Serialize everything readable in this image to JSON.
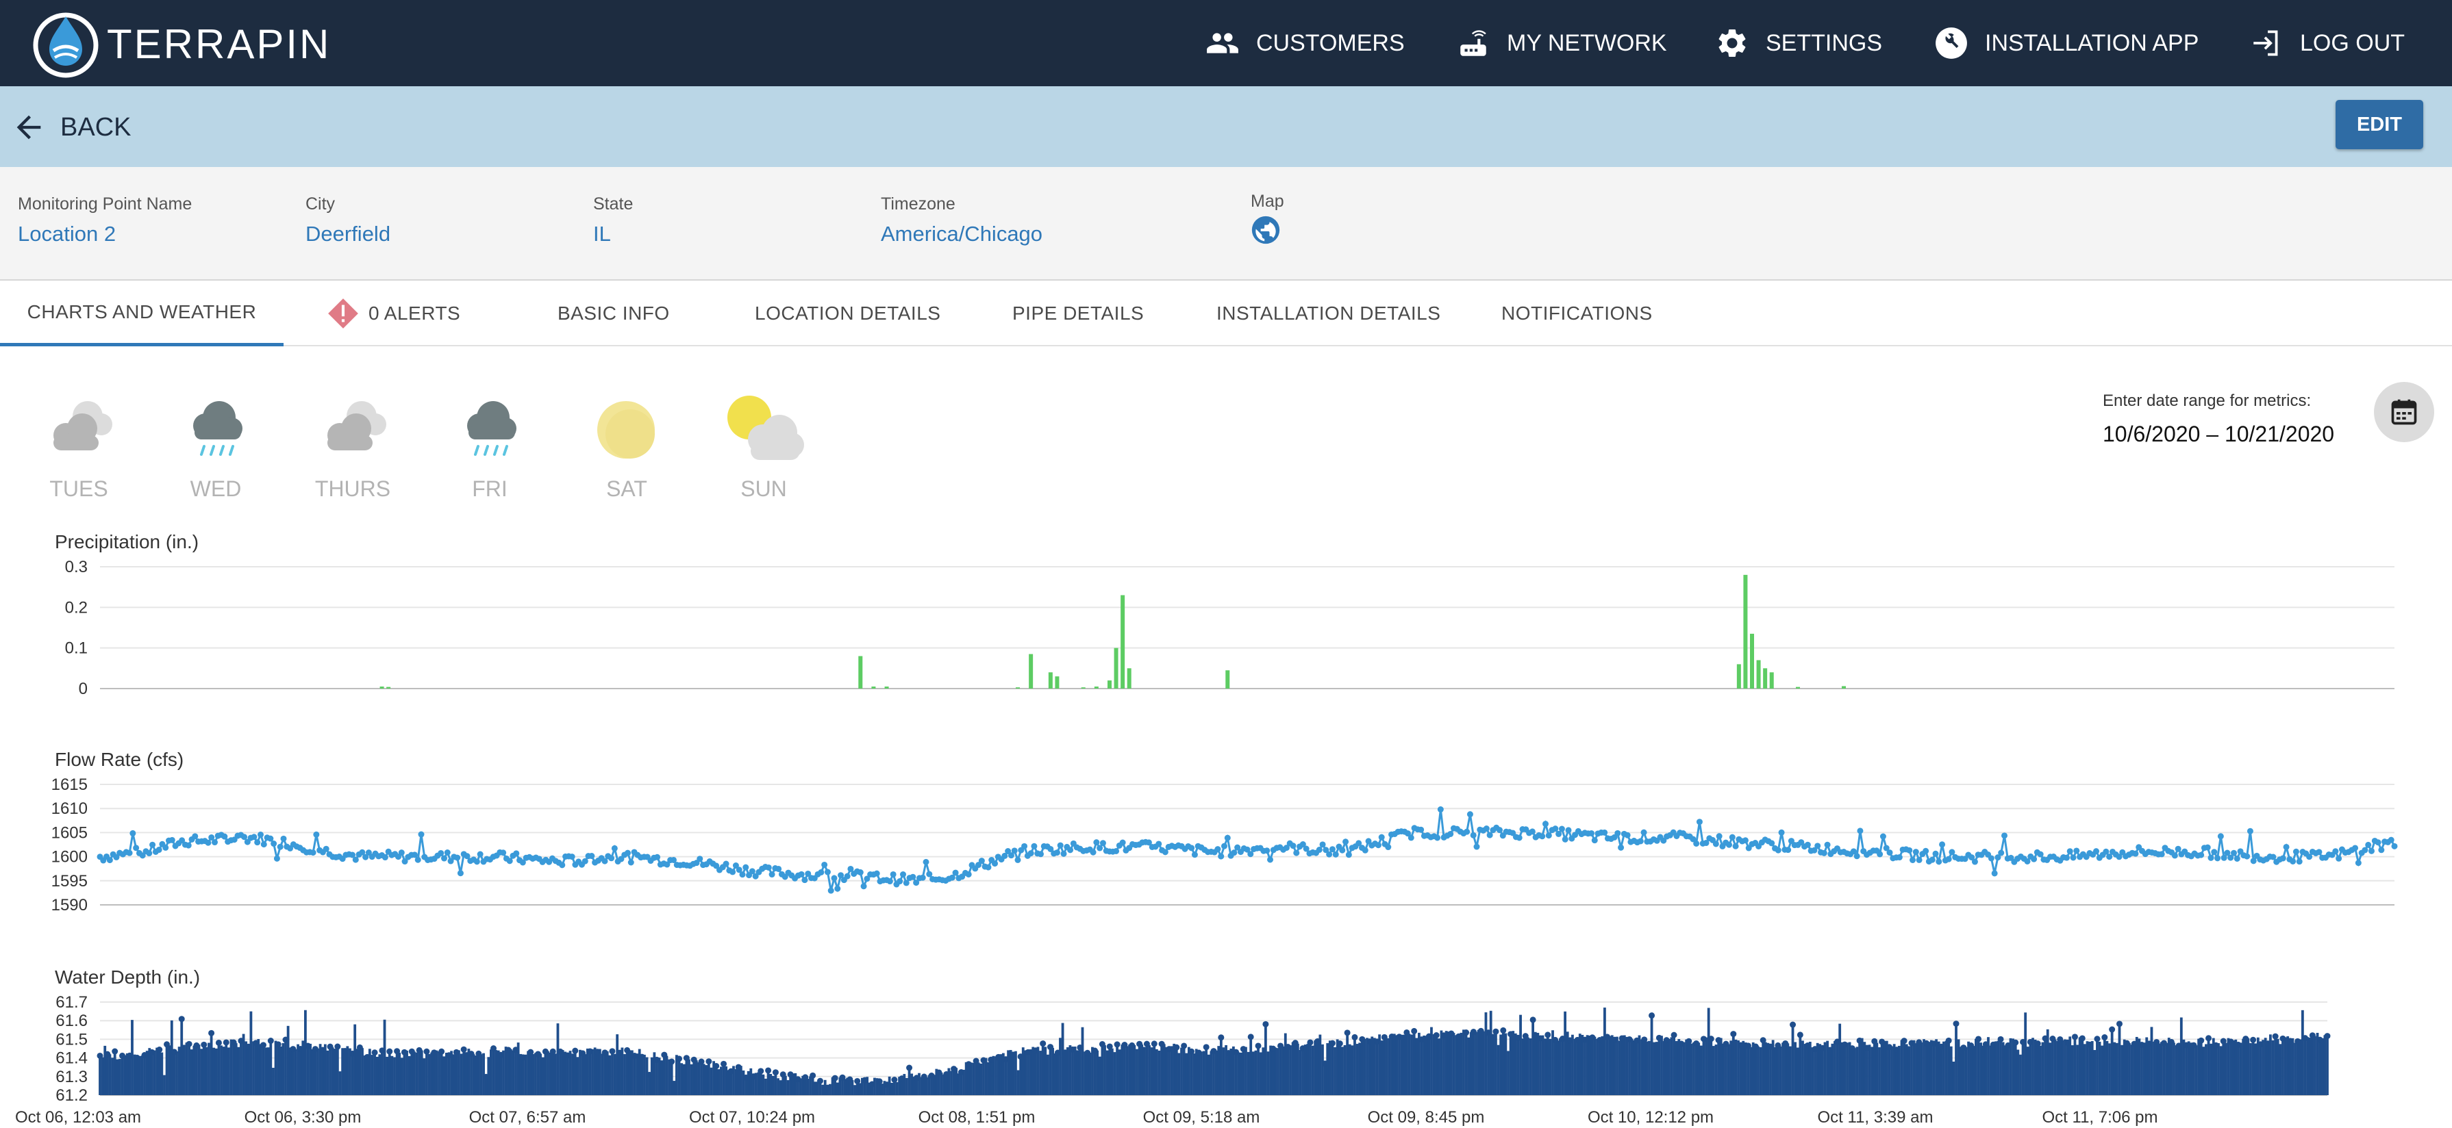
{
  "brand": {
    "name": "TERRAPIN",
    "icon": "terrapin-drop-logo"
  },
  "nav": [
    {
      "label": "CUSTOMERS",
      "icon": "people-icon"
    },
    {
      "label": "MY NETWORK",
      "icon": "router-icon"
    },
    {
      "label": "SETTINGS",
      "icon": "gear-icon"
    },
    {
      "label": "INSTALLATION APP",
      "icon": "wrench-icon"
    },
    {
      "label": "LOG OUT",
      "icon": "logout-icon"
    }
  ],
  "backbar": {
    "back_label": "BACK",
    "edit_label": "EDIT"
  },
  "info": [
    {
      "label": "Monitoring Point Name",
      "value": "Location 2"
    },
    {
      "label": "City",
      "value": "Deerfield"
    },
    {
      "label": "State",
      "value": "IL"
    },
    {
      "label": "Timezone",
      "value": "America/Chicago"
    },
    {
      "label": "Map",
      "icon": "globe-icon"
    }
  ],
  "tabs": [
    {
      "label": "CHARTS AND WEATHER",
      "active": true
    },
    {
      "label": "0 ALERTS",
      "icon": "alert-diamond-icon"
    },
    {
      "label": "BASIC INFO"
    },
    {
      "label": "LOCATION DETAILS"
    },
    {
      "label": "PIPE DETAILS"
    },
    {
      "label": "INSTALLATION DETAILS"
    },
    {
      "label": "NOTIFICATIONS"
    }
  ],
  "weather": [
    {
      "day": "TUES",
      "icon": "cloudy-icon"
    },
    {
      "day": "WED",
      "icon": "rain-icon"
    },
    {
      "day": "THURS",
      "icon": "cloudy-icon"
    },
    {
      "day": "FRI",
      "icon": "rain-icon"
    },
    {
      "day": "SAT",
      "icon": "sun-icon"
    },
    {
      "day": "SUN",
      "icon": "partly-cloudy-icon"
    }
  ],
  "date_range": {
    "label": "Enter date range for metrics:",
    "value": "10/6/2020 – 10/21/2020",
    "icon": "calendar-icon"
  },
  "colors": {
    "navbar": "#1d2c40",
    "backbar": "#bad6e6",
    "link": "#2f78b8",
    "precip": "#5dcc63",
    "flow": "#3a9ad9",
    "depth": "#1f4e8c",
    "alert": "#e07b86"
  },
  "chart_data": [
    {
      "type": "bar",
      "title": "Precipitation (in.)",
      "ylabel": "Precipitation (in.)",
      "ylim": [
        0,
        0.3
      ],
      "yticks": [
        "0.3",
        "0.2",
        "0.1",
        "0"
      ],
      "x_index_range": [
        0,
        350
      ],
      "points": [
        [
          43,
          0.005
        ],
        [
          44,
          0.004
        ],
        [
          116,
          0.08
        ],
        [
          118,
          0.005
        ],
        [
          120,
          0.005
        ],
        [
          140,
          0.003
        ],
        [
          142,
          0.085
        ],
        [
          145,
          0.04
        ],
        [
          146,
          0.03
        ],
        [
          150,
          0.003
        ],
        [
          152,
          0.005
        ],
        [
          154,
          0.02
        ],
        [
          155,
          0.1
        ],
        [
          156,
          0.23
        ],
        [
          157,
          0.05
        ],
        [
          172,
          0.045
        ],
        [
          250,
          0.06
        ],
        [
          251,
          0.28
        ],
        [
          252,
          0.135
        ],
        [
          253,
          0.07
        ],
        [
          254,
          0.05
        ],
        [
          255,
          0.04
        ],
        [
          259,
          0.004
        ],
        [
          266,
          0.006
        ]
      ],
      "grid": true
    },
    {
      "type": "scatter",
      "title": "Flow Rate (cfs)",
      "ylabel": "Flow Rate (cfs)",
      "ylim": [
        1590,
        1615
      ],
      "yticks": [
        "1615",
        "1610",
        "1605",
        "1600",
        "1595",
        "1590"
      ],
      "trend_x": [
        0,
        7,
        12,
        23,
        28,
        35,
        40,
        50,
        60,
        70,
        80,
        90,
        100,
        110,
        115,
        125,
        130,
        140,
        150,
        160,
        170,
        180,
        190,
        200,
        210,
        220,
        230,
        240,
        250,
        260,
        270,
        280,
        290,
        300,
        310,
        320,
        330,
        340,
        350
      ],
      "trend_y": [
        1600,
        1601,
        1603,
        1604,
        1603,
        1601,
        1600,
        1600,
        1600,
        1599,
        1600,
        1599,
        1597,
        1596,
        1596,
        1595,
        1596,
        1601,
        1602,
        1602,
        1601,
        1602,
        1601,
        1605,
        1605,
        1605,
        1604,
        1604,
        1603,
        1602,
        1601,
        1600,
        1600,
        1600,
        1601,
        1601,
        1600,
        1600,
        1603
      ],
      "grid": true
    },
    {
      "type": "bar",
      "title": "Water Depth (in.)",
      "ylabel": "Water Depth (in.)",
      "ylim": [
        61.2,
        61.7
      ],
      "yticks": [
        "61.7",
        "61.6",
        "61.5",
        "61.4",
        "61.3",
        "61.2"
      ],
      "trend_x": [
        0,
        10,
        20,
        25,
        35,
        40,
        50,
        60,
        70,
        80,
        90,
        100,
        110,
        115,
        120,
        130,
        140,
        150,
        160,
        170,
        180,
        190,
        200,
        210,
        220,
        230,
        240,
        250,
        260,
        270,
        280,
        290,
        300,
        310,
        320,
        330,
        340
      ],
      "trend_y": [
        61.4,
        61.45,
        61.48,
        61.48,
        61.46,
        61.43,
        61.42,
        61.43,
        61.42,
        61.44,
        61.38,
        61.32,
        61.28,
        61.27,
        61.28,
        61.33,
        61.43,
        61.45,
        61.46,
        61.44,
        61.46,
        61.48,
        61.52,
        61.53,
        61.52,
        61.51,
        61.5,
        61.48,
        61.47,
        61.47,
        61.48,
        61.48,
        61.49,
        61.49,
        61.48,
        61.49,
        61.5
      ],
      "x_tick_labels": [
        "Oct 06, 12:03 am",
        "Oct 06, 3:30 pm",
        "Oct 07, 6:57 am",
        "Oct 07, 10:24 pm",
        "Oct 08, 1:51 pm",
        "Oct 09, 5:18 am",
        "Oct 09, 8:45 pm",
        "Oct 10, 12:12 pm",
        "Oct 11, 3:39 am",
        "Oct 11, 7:06 pm"
      ],
      "grid": true
    }
  ]
}
